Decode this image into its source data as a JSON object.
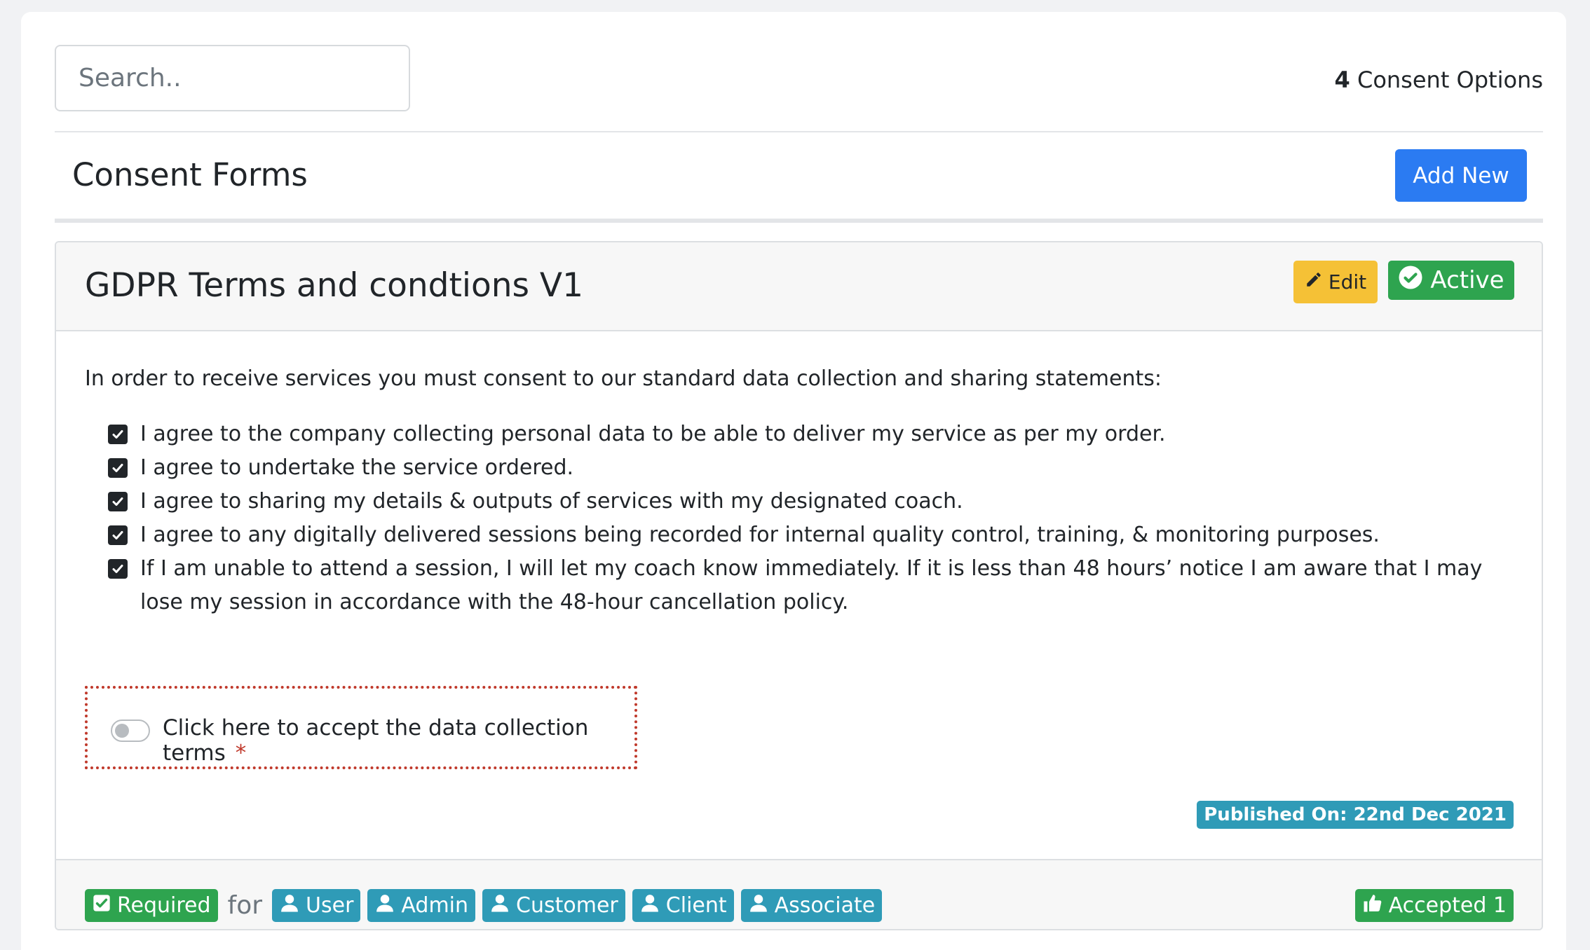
{
  "search": {
    "placeholder": "Search.."
  },
  "count": {
    "number": "4",
    "label": "Consent Options"
  },
  "header": {
    "title": "Consent Forms",
    "add_label": "Add New"
  },
  "form": {
    "title": "GDPR Terms and condtions V1",
    "edit_label": "Edit",
    "status_label": "Active",
    "intro": "In order to receive services you must consent to our standard data collection and sharing statements:",
    "terms": [
      "I agree to the company collecting personal data to be able to deliver my service as per my order.",
      "I agree to undertake the service ordered.",
      "I agree to sharing my details & outputs of services with my designated coach.",
      "I agree to any digitally delivered sessions being recorded for internal quality control, training, & monitoring purposes.",
      "If I am unable to attend a session, I will let my coach know immediately. If it is less than 48 hours’ notice I am aware that I may lose my session in accordance with the 48-hour cancellation policy."
    ],
    "accept_label": "Click here to accept the data collection terms",
    "required_marker": "*",
    "published": "Published On: 22nd Dec 2021"
  },
  "footer": {
    "required_label": "Required",
    "for_label": "for",
    "roles": [
      "User",
      "Admin",
      "Customer",
      "Client",
      "Associate"
    ],
    "accepted_label": "Accepted 1"
  },
  "colors": {
    "primary": "#2b7bf2",
    "warning": "#f5c136",
    "success": "#2ea44f",
    "info": "#2f9bb7",
    "danger": "#c0392b"
  }
}
